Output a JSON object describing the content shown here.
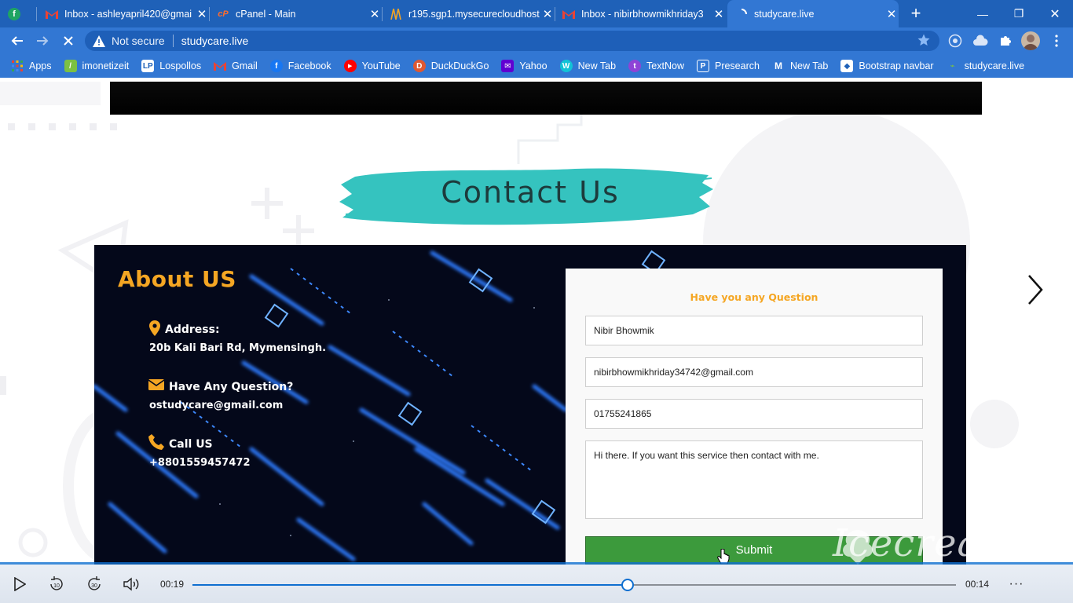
{
  "browser": {
    "tabs": [
      {
        "title": "",
        "icon": "green-f"
      },
      {
        "title": "Inbox - ashleyapril420@gmai",
        "icon": "gmail"
      },
      {
        "title": "cPanel - Main",
        "icon": "cpanel"
      },
      {
        "title": "r195.sgp1.mysecurecloudhost",
        "icon": "server"
      },
      {
        "title": "Inbox - nibirbhowmikhriday3",
        "icon": "gmail"
      },
      {
        "title": "studycare.live",
        "icon": "loading",
        "active": true
      }
    ],
    "address": {
      "security": "Not secure",
      "url": "studycare.live"
    },
    "bookmarks": [
      {
        "label": "Apps",
        "icon": "apps-grid"
      },
      {
        "label": "imonetizeit",
        "icon": "imonetizeit"
      },
      {
        "label": "Lospollos",
        "icon": "lp"
      },
      {
        "label": "Gmail",
        "icon": "gmail"
      },
      {
        "label": "Facebook",
        "icon": "facebook"
      },
      {
        "label": "YouTube",
        "icon": "youtube"
      },
      {
        "label": "DuckDuckGo",
        "icon": "duckduckgo"
      },
      {
        "label": "Yahoo",
        "icon": "yahoo"
      },
      {
        "label": "New Tab",
        "icon": "w-logo"
      },
      {
        "label": "TextNow",
        "icon": "textnow"
      },
      {
        "label": "Presearch",
        "icon": "presearch"
      },
      {
        "label": "New Tab",
        "icon": "m-logo"
      },
      {
        "label": "Bootstrap navbar",
        "icon": "bootstrap"
      },
      {
        "label": "studycare.live",
        "icon": "studycare"
      }
    ]
  },
  "page": {
    "section_title": "Contact Us",
    "about": {
      "title": "About US",
      "address_label": "Address:",
      "address_value": "20b Kali Bari Rd, Mymensingh.",
      "question_label": "Have Any Question?",
      "question_value": "ostudycare@gmail.com",
      "call_label": "Call US",
      "call_value": "+8801559457472"
    },
    "form": {
      "heading": "Have you any Question",
      "name": "Nibir Bhowmik",
      "email": "nibirbhowmikhriday34742@gmail.com",
      "phone": "01755241865",
      "message": "Hi there. If you want this service then contact with me.",
      "submit_label": "Submit"
    },
    "watermark": "Icecream"
  },
  "player": {
    "elapsed": "00:19",
    "remaining": "00:14",
    "progress": 0.57
  },
  "colors": {
    "accent_orange": "#f5a623",
    "brush_teal": "#35c3bf",
    "browser_blue": "#3277d3",
    "submit_green": "#3c9a3c"
  }
}
